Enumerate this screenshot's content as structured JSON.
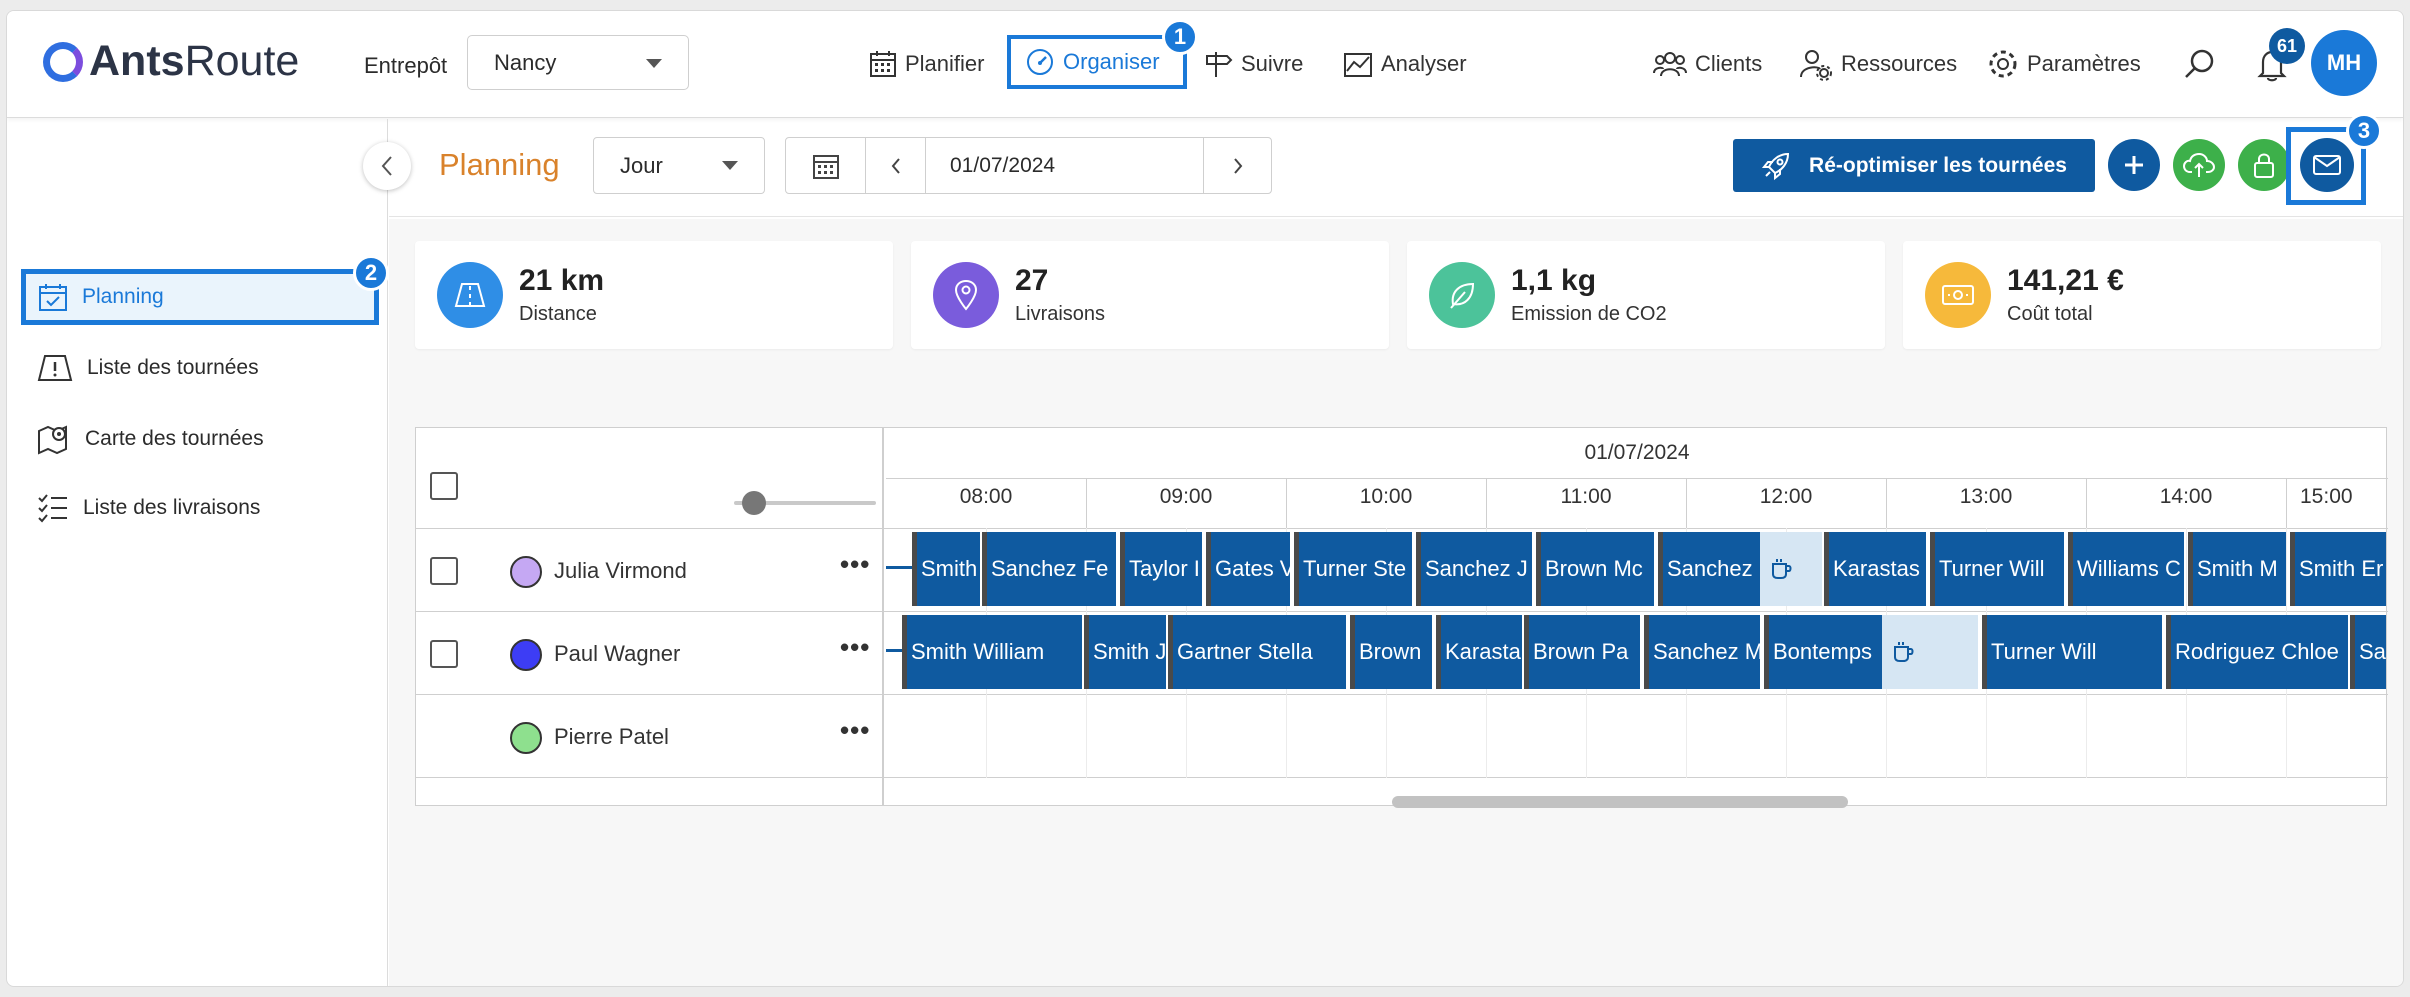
{
  "app": {
    "logo_bold": "Ants",
    "logo_light": "Route"
  },
  "warehouse": {
    "label": "Entrepôt",
    "value": "Nancy"
  },
  "nav": [
    {
      "label": "Planifier",
      "icon": "calendar-icon"
    },
    {
      "label": "Organiser",
      "icon": "speedometer-icon",
      "active": true,
      "badge": "1"
    },
    {
      "label": "Suivre",
      "icon": "signpost-icon"
    },
    {
      "label": "Analyser",
      "icon": "chart-icon"
    }
  ],
  "right_nav": [
    {
      "label": "Clients",
      "icon": "users-icon"
    },
    {
      "label": "Ressources",
      "icon": "user-gear-icon"
    },
    {
      "label": "Paramètres",
      "icon": "gear-icon"
    }
  ],
  "notifications": {
    "count": "61"
  },
  "user": {
    "initials": "MH"
  },
  "sidebar": {
    "items": [
      {
        "label": "Planning",
        "active": true,
        "badge": "2"
      },
      {
        "label": "Liste des tournées"
      },
      {
        "label": "Carte des tournées"
      },
      {
        "label": "Liste des livraisons"
      }
    ]
  },
  "toolbar": {
    "title": "Planning",
    "view": "Jour",
    "date": "01/07/2024",
    "reoptimize_label": "Ré-optimiser les tournées",
    "mail_badge": "3"
  },
  "colors": {
    "primary": "#0f5aa0",
    "accent": "#1a79d8",
    "title": "#d9822b",
    "green": "#3db04a"
  },
  "kpis": [
    {
      "value": "21 km",
      "label": "Distance",
      "color": "#2f8ee6",
      "icon": "road-icon"
    },
    {
      "value": "27",
      "label": "Livraisons",
      "color": "#7a5cdc",
      "icon": "location-pin-icon"
    },
    {
      "value": "1,1 kg",
      "label": "Emission de CO2",
      "color": "#4cc39a",
      "icon": "leaf-icon"
    },
    {
      "value": "141,21 €",
      "label": "Coût total",
      "color": "#f6b93b",
      "icon": "money-icon"
    }
  ],
  "schedule": {
    "date": "01/07/2024",
    "hours": [
      "08:00",
      "09:00",
      "10:00",
      "11:00",
      "12:00",
      "13:00",
      "14:00",
      "15:00"
    ],
    "resources": [
      {
        "name": "Julia Virmond",
        "color": "#c5a8f3"
      },
      {
        "name": "Paul Wagner",
        "color": "#3d3df5"
      },
      {
        "name": "Pierre Patel",
        "color": "#8ee08e"
      }
    ],
    "rows": [
      [
        "Smith",
        "Sanchez Fe",
        "Taylor I",
        "Gates V",
        "Turner Ste",
        "Sanchez J",
        "Brown Mc",
        "Sanchez",
        "Karastas",
        "Turner Will",
        "Williams C",
        "Smith M",
        "Smith Er"
      ],
      [
        "Smith William",
        "Smith J",
        "Gartner Stella",
        "Brown",
        "Karasta",
        "Brown Pa",
        "Sanchez M",
        "Bontemps",
        "Turner Will",
        "Rodriguez Chloe",
        "Sa"
      ]
    ]
  }
}
